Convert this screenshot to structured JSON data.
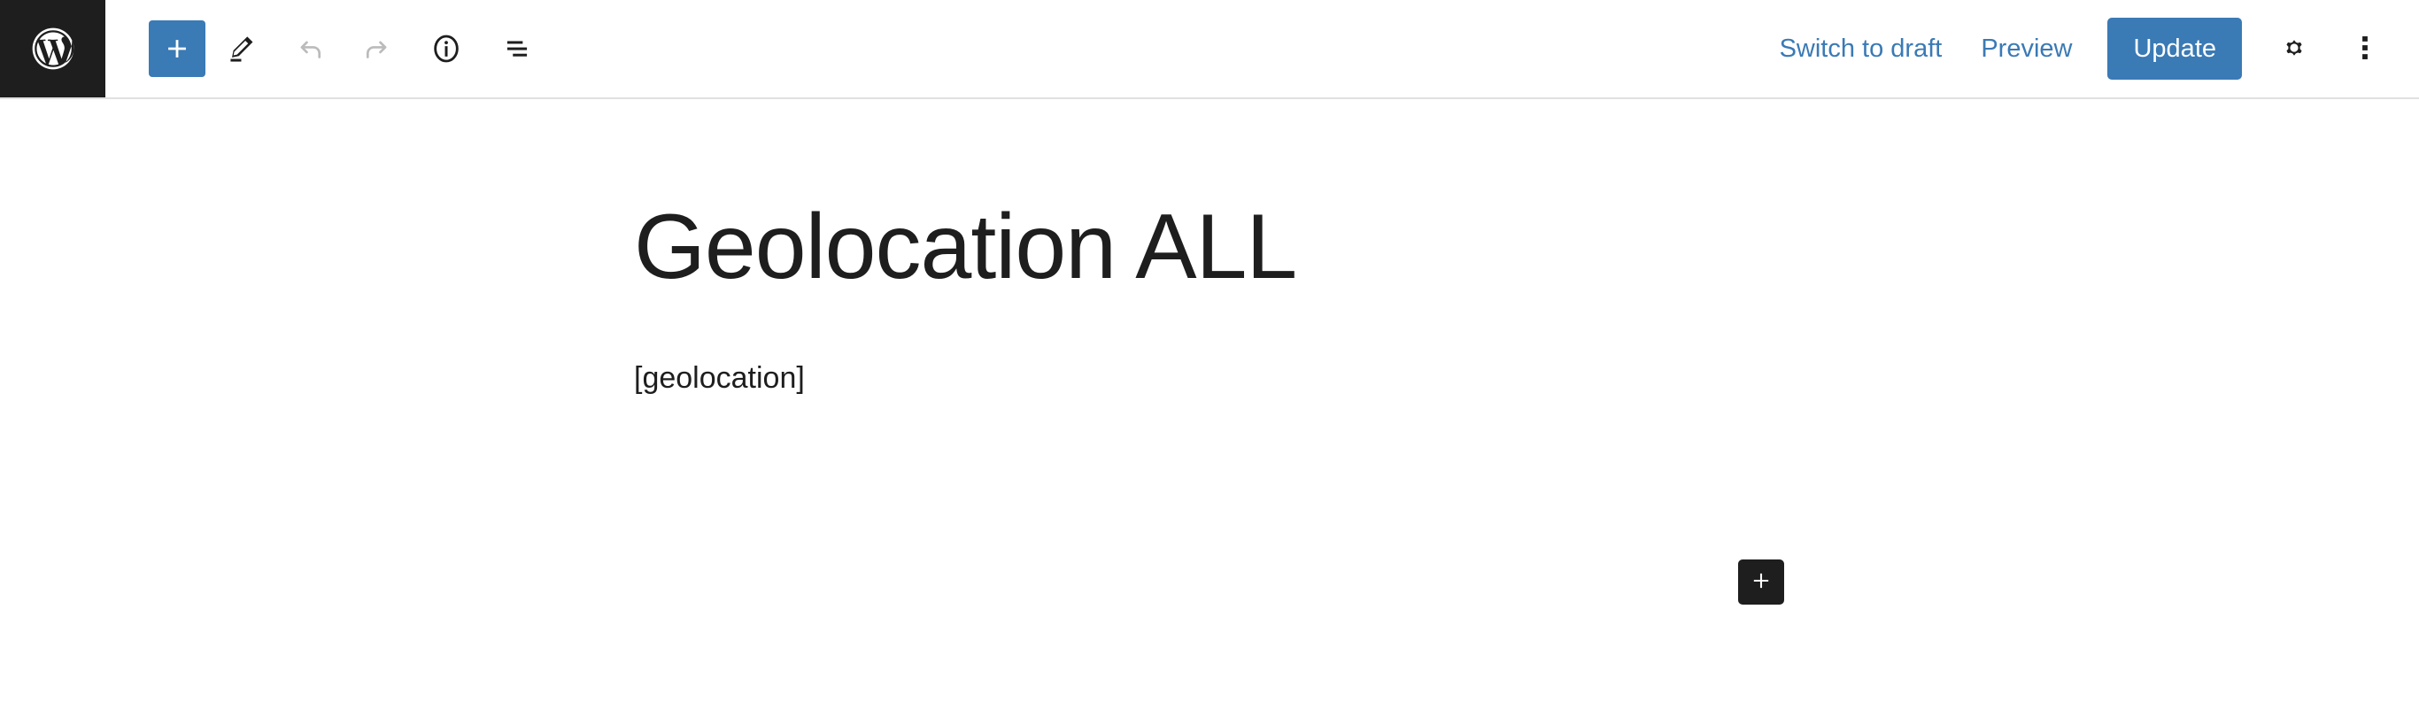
{
  "app": {
    "name": "WordPress Block Editor",
    "logo_icon": "wordpress-logo-icon"
  },
  "toolbar": {
    "left_tools": [
      {
        "name": "add-block-inserter-button",
        "icon": "plus-icon",
        "label": "Toggle block inserter",
        "state": "active"
      },
      {
        "name": "tools-edit-button",
        "icon": "pencil-icon",
        "label": "Tools",
        "state": "default"
      },
      {
        "name": "undo-button",
        "icon": "undo-arrow-icon",
        "label": "Undo",
        "state": "disabled"
      },
      {
        "name": "redo-button",
        "icon": "redo-arrow-icon",
        "label": "Redo",
        "state": "default"
      },
      {
        "name": "details-button",
        "icon": "info-circle-icon",
        "label": "Details",
        "state": "default"
      },
      {
        "name": "list-view-button",
        "icon": "list-view-icon",
        "label": "List View",
        "state": "default"
      }
    ],
    "switch_to_draft_label": "Switch to draft",
    "preview_label": "Preview",
    "update_label": "Update",
    "settings_icon": "gear-icon",
    "settings_label": "Settings",
    "options_icon": "kebab-menu-icon",
    "options_label": "Options"
  },
  "editor": {
    "title": "Geolocation ALL",
    "title_placeholder": "Add title",
    "blocks": [
      {
        "type": "paragraph",
        "text": "[geolocation]"
      }
    ],
    "inserter_icon": "plus-icon",
    "inserter_label": "Add block"
  },
  "colors": {
    "accent_blue": "#3a7ab5",
    "dark": "#1e1e1e",
    "border": "#e0e0e0",
    "disabled_gray": "#bbbbbb",
    "background": "#ffffff"
  }
}
